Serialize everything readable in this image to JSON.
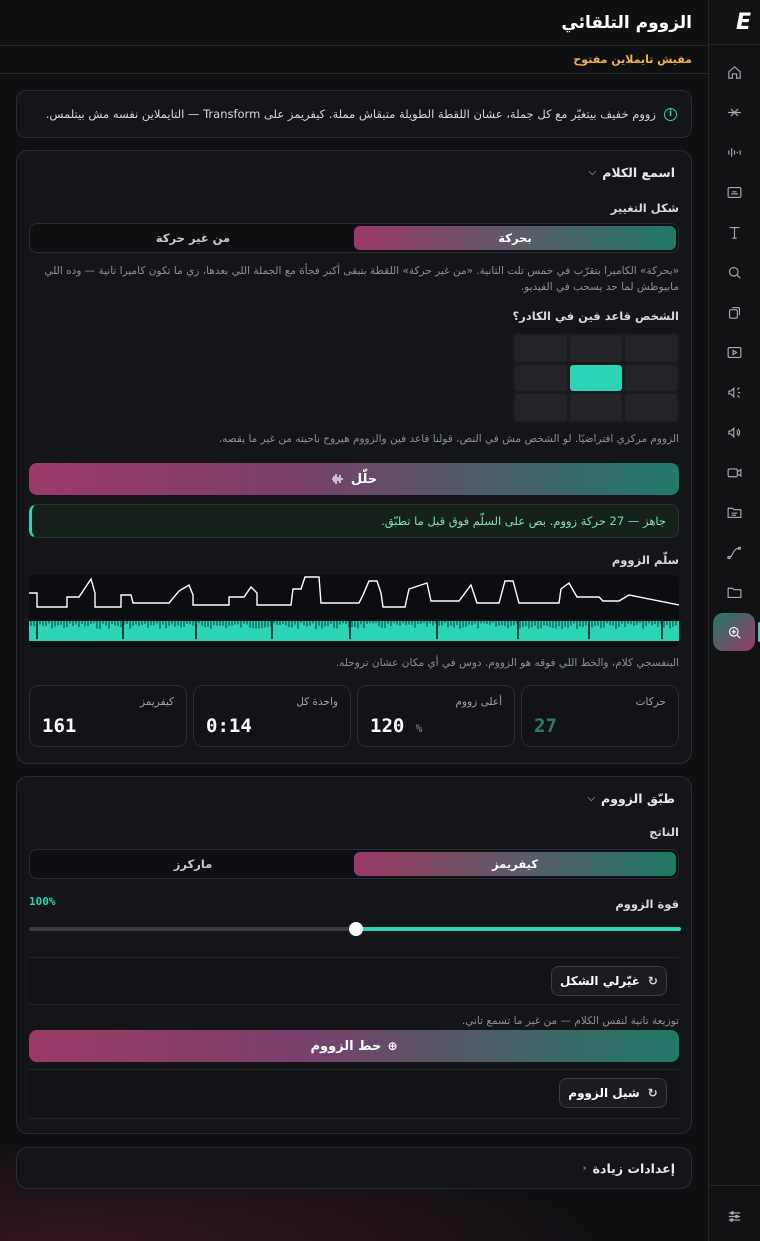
{
  "app": {
    "logo_text": "E"
  },
  "header": {
    "title": "الزووم التلقائي",
    "subtitle": "مفيش تايملاين مفتوح"
  },
  "info": {
    "text": "زووم خفيف بيتغيّر مع كل جملة، عشان اللقطة الطويلة متبقاش مملة. كيفريمز على Transform — التايملاين نفسه مش بيتلمس."
  },
  "listen_panel": {
    "title": "اسمع الكلام",
    "shape_label": "شكل التغيير",
    "shape_options": [
      "بحركة",
      "من غير حركة"
    ],
    "shape_selected": "بحركة",
    "shape_help": "«بحركة» الكاميرا بتقرّب في خمس تلت الثانية. «من غير حركة» اللقطة بتبقى أكبر فجأة مع الجملة اللي بعدها، زي ما تكون كاميرا تانية — وده اللي مابيوظش لما حد يسحب في الفيديو.",
    "position_label": "الشخص قاعد فين في الكادر؟",
    "position_selected": "top-center",
    "position_help": "الزووم مركزي افتراضيًا. لو الشخص مش في النص، قولنا قاعد فين والزووم هيروح ناحيته من غير ما يقصه.",
    "analyze_button": "حلّل",
    "status_text": "جاهز — 27 حركة زووم. بص على السلّم فوق قبل ما تطبّق.",
    "stair_label": "سلّم الزووم",
    "stair_help": "البنفسجي كلام، والخط اللي فوقه هو الزووم. دوس في أي مكان عشان تروحله.",
    "stats": [
      {
        "title": "حركات",
        "value": "27",
        "unit": ""
      },
      {
        "title": "أعلى زووم",
        "value": "120",
        "unit": "%"
      },
      {
        "title": "واحدة كل",
        "value": "0:14",
        "unit": ""
      },
      {
        "title": "كيفريمز",
        "value": "161",
        "unit": ""
      }
    ]
  },
  "apply_panel": {
    "title": "طبّق الزووم",
    "result_label": "الناتج",
    "result_options": [
      "كيفريمز",
      "ماركرز"
    ],
    "result_selected": "كيفريمز",
    "strength_label": "قوة الزووم",
    "strength_value": "100%",
    "strength_fraction": 0.5,
    "reshape_button": "غيّرلي الشكل",
    "reshape_help": "توزيعة تانية لنفس الكلام — من غير ما تسمع تاني.",
    "apply_button": "حط الزووم",
    "remove_button": "شيل الزووم"
  },
  "more_settings": {
    "title": "إعدادات زيادة"
  },
  "sidebar": {
    "items": [
      {
        "name": "home-icon",
        "active": false
      },
      {
        "name": "cut-icon",
        "active": false
      },
      {
        "name": "waveform-icon",
        "active": false
      },
      {
        "name": "captions-icon",
        "active": false
      },
      {
        "name": "text-icon",
        "active": false
      },
      {
        "name": "search-icon",
        "active": false
      },
      {
        "name": "copy-icon",
        "active": false
      },
      {
        "name": "video-icon",
        "active": false
      },
      {
        "name": "audio-fx-icon",
        "active": false
      },
      {
        "name": "volume-icon",
        "active": false
      },
      {
        "name": "camera-icon",
        "active": false
      },
      {
        "name": "folder-list-icon",
        "active": false
      },
      {
        "name": "curve-icon",
        "active": false
      },
      {
        "name": "folder-icon",
        "active": false
      },
      {
        "name": "zoom-icon",
        "active": true
      }
    ],
    "bottom": "sliders-icon"
  },
  "colors": {
    "accent": "#2ad4b4",
    "brand": "#9c3a66",
    "warning": "#f2b24a"
  }
}
